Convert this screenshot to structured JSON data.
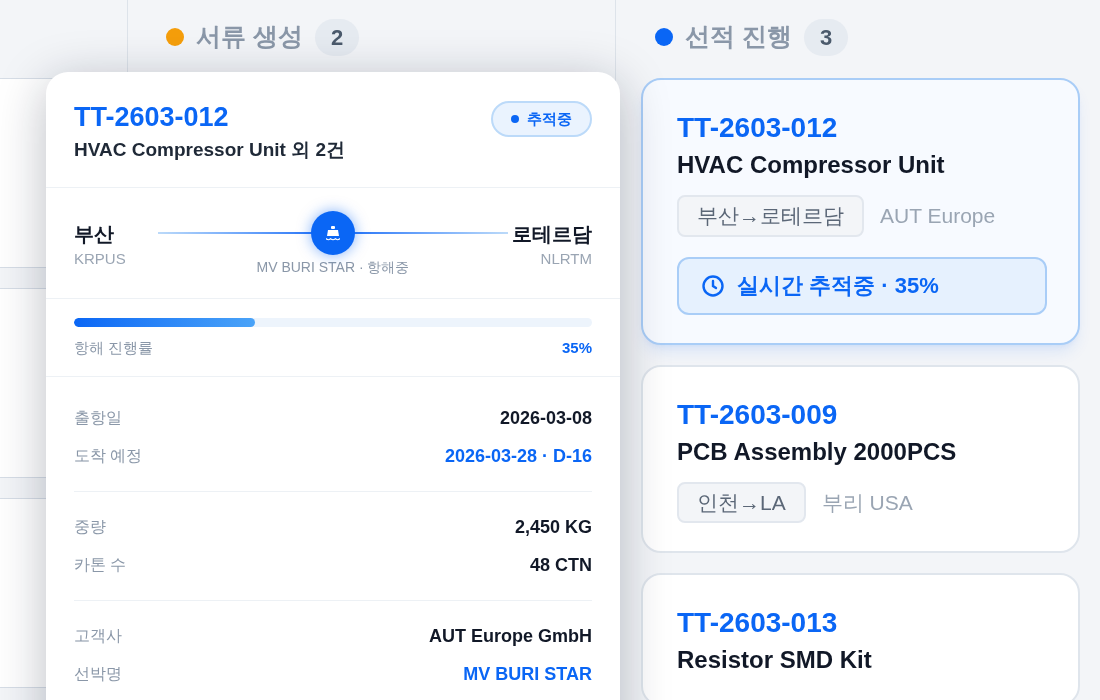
{
  "columns": [
    {
      "title": "서류 생성",
      "color": "#f59e0b",
      "count": "2"
    },
    {
      "title": "선적 진행",
      "color": "#0a66f5",
      "count": "3"
    }
  ],
  "cards": [
    {
      "id": "TT-2603-012",
      "title": "HVAC Compressor Unit",
      "route": "부산→로테르담",
      "customer": "AUT Europe",
      "tracking": "실시간 추적중 · 35%",
      "selected": true
    },
    {
      "id": "TT-2603-009",
      "title": "PCB Assembly 2000PCS",
      "route": "인천→LA",
      "customer": "부리 USA",
      "selected": false
    },
    {
      "id": "TT-2603-013",
      "title": "Resistor SMD Kit",
      "selected": false
    }
  ],
  "detail_popover": {
    "id": "TT-2603-012",
    "subtitle": "HVAC Compressor Unit 외 2건",
    "status": "추적중",
    "origin": {
      "city": "부산",
      "code": "KRPUS"
    },
    "destination": {
      "city": "로테르담",
      "code": "NLRTM"
    },
    "vessel_caption": "MV BURI STAR · 항해중",
    "progress": {
      "label": "항해 진행률",
      "reading": "35%",
      "level": 0.35
    },
    "groups": [
      [
        {
          "label": "출항일",
          "value": "2026-03-08",
          "highlight": false
        },
        {
          "label": "도착 예정",
          "value": "2026-03-28 · D-16",
          "highlight": true
        }
      ],
      [
        {
          "label": "중량",
          "value": "2,450 KG",
          "highlight": false
        },
        {
          "label": "카톤 수",
          "value": "48 CTN",
          "highlight": false
        }
      ],
      [
        {
          "label": "고객사",
          "value": "AUT Europe GmbH",
          "highlight": false
        },
        {
          "label": "선박명",
          "value": "MV BURI STAR",
          "highlight": true
        }
      ]
    ]
  }
}
